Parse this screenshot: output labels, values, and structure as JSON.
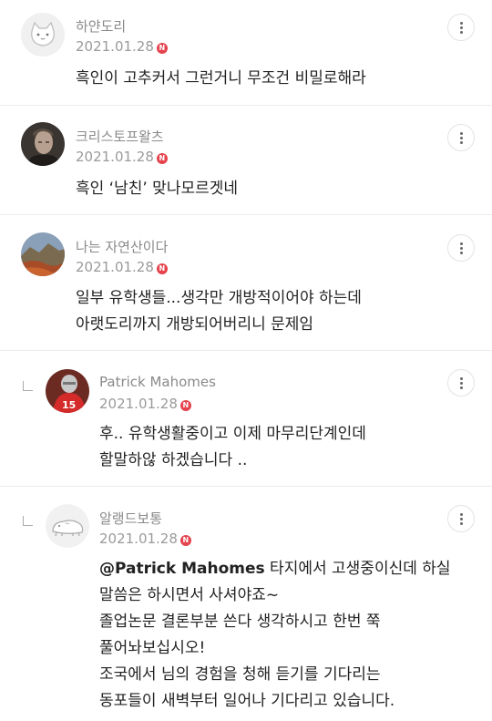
{
  "comments": [
    {
      "author": "하얀도리",
      "date": "2021.01.28",
      "badge": "N",
      "avatar_icon": "cat-avatar-icon",
      "lines": [
        "흑인이 고추커서 그런거니 무조건 비밀로해라"
      ]
    },
    {
      "author": "크리스토프왈츠",
      "date": "2021.01.28",
      "badge": "N",
      "avatar_icon": "portrait-photo",
      "lines": [
        "흑인 ‘남친’ 맞나모르겟네"
      ]
    },
    {
      "author": "나는 자연산이다",
      "date": "2021.01.28",
      "badge": "N",
      "avatar_icon": "landscape-photo",
      "lines": [
        "일부 유학생들...생각만 개방적이어야 하는데",
        "아랫도리까지 개방되어버리니 문제임"
      ]
    },
    {
      "author": "Patrick Mahomes",
      "date": "2021.01.28",
      "badge": "N",
      "avatar_icon": "football-player-photo",
      "is_reply": true,
      "lines": [
        "후.. 유학생활중이고 이제 마무리단계인데",
        "할말하않 하겠습니다 .."
      ]
    },
    {
      "author": "알랭드보통",
      "date": "2021.01.28",
      "badge": "N",
      "avatar_icon": "animal-avatar-icon",
      "is_reply": true,
      "mention": "@Patrick Mahomes",
      "first_line_rest": " 타지에서 고생중이신데 하실",
      "lines": [
        "말씀은 하시면서 사셔야죠~",
        "졸업논문 결론부분 쓴다 생각하시고 한번 쭉",
        "풀어놔보십시오!",
        "조국에서 님의 경험을 청해 듣기를 기다리는",
        "동포들이 새벽부터 일어나 기다리고 있습니다."
      ]
    }
  ],
  "more_icon": "more-vertical-icon",
  "reply_icon": "reply-arrow-icon"
}
